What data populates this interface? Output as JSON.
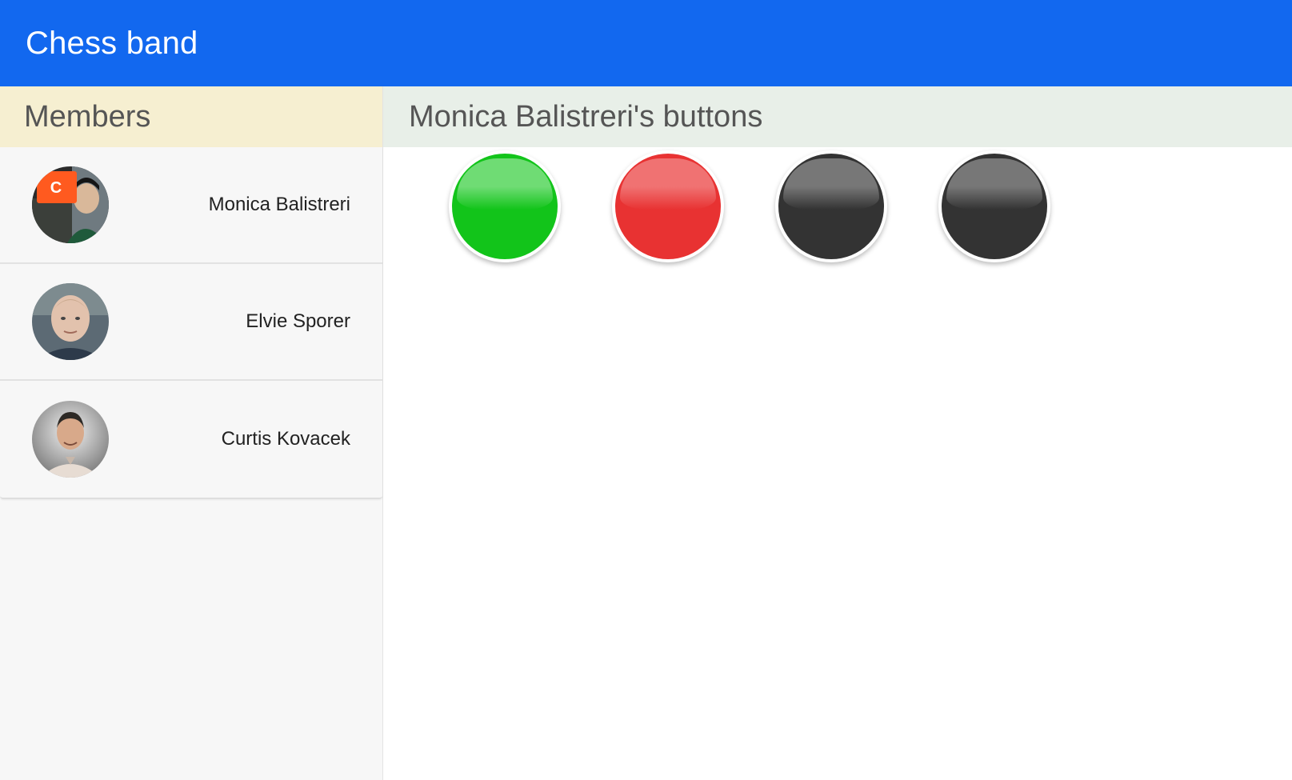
{
  "app": {
    "title": "Chess band"
  },
  "sidebar": {
    "header": "Members",
    "members": [
      {
        "name": "Monica Balistreri",
        "avatar_icon": "person-avatar-icon",
        "badge_letter": "C"
      },
      {
        "name": "Elvie Sporer",
        "avatar_icon": "person-avatar-icon"
      },
      {
        "name": "Curtis Kovacek",
        "avatar_icon": "person-avatar-icon"
      }
    ]
  },
  "main": {
    "header": "Monica Balistreri's buttons",
    "buttons": [
      {
        "color": "#12c41a",
        "rim": "#0c9a12",
        "shine": "#6fdc74",
        "state": "green"
      },
      {
        "color": "#e83232",
        "rim": "#c81f1f",
        "shine": "#f07272",
        "state": "red"
      },
      {
        "color": "#333333",
        "rim": "#1e1e1e",
        "shine": "#777777",
        "state": "off"
      },
      {
        "color": "#333333",
        "rim": "#1e1e1e",
        "shine": "#777777",
        "state": "off"
      }
    ]
  },
  "colors": {
    "topbar": "#1268ef",
    "members_header_bg": "#f6efd1",
    "buttons_header_bg": "#e8efe8"
  }
}
